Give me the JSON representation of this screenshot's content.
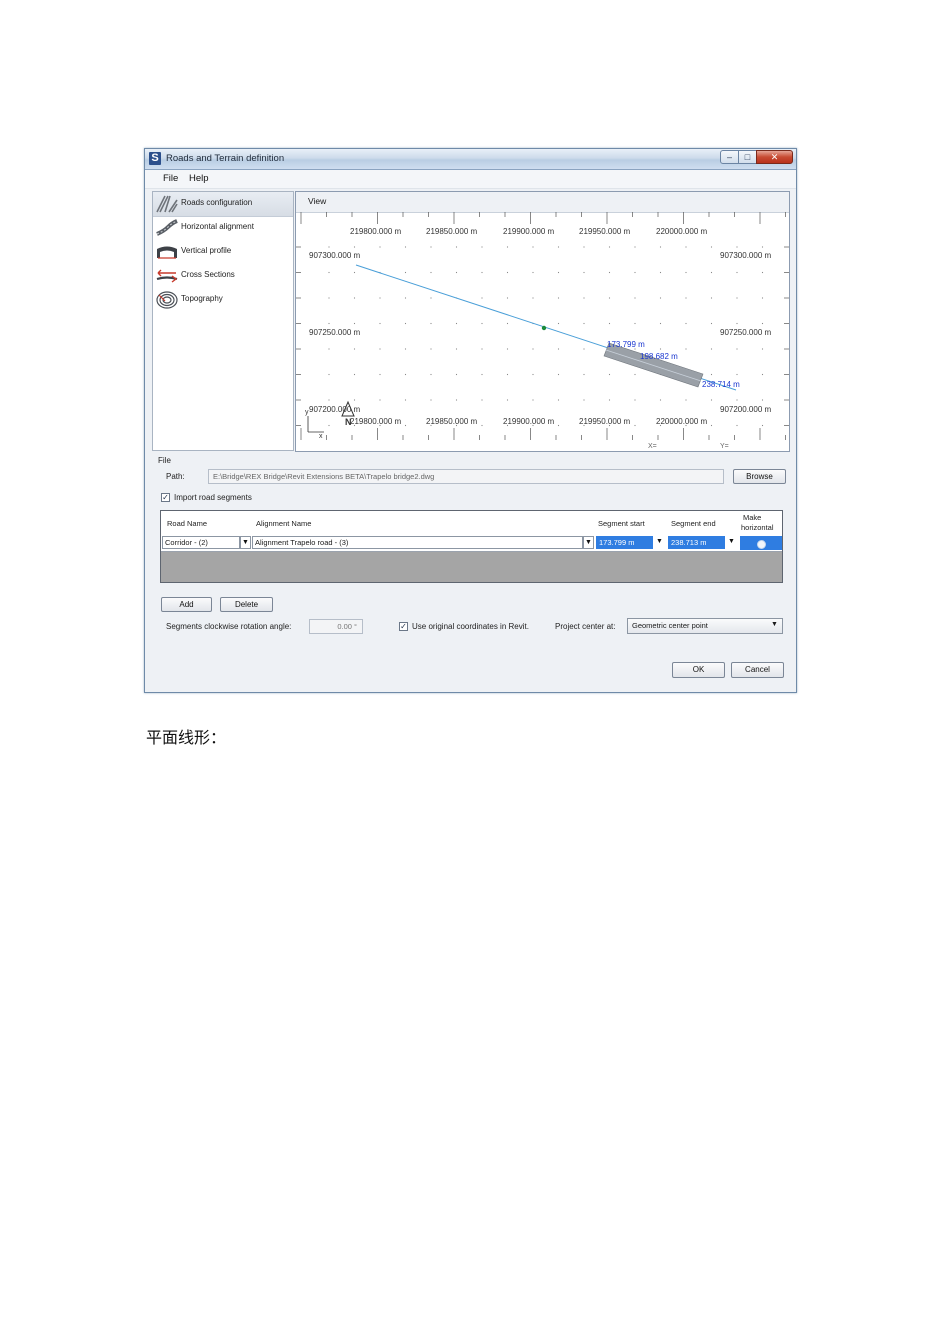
{
  "window": {
    "title": "Roads and Terrain definition",
    "controls": {
      "minimize": "–",
      "maximize": "□",
      "close": "✕"
    }
  },
  "menu": {
    "file": "File",
    "help": "Help"
  },
  "nav": {
    "items": [
      {
        "label": "Roads configuration",
        "icon": "roads-icon",
        "selected": true
      },
      {
        "label": "Horizontal alignment",
        "icon": "alignment-icon",
        "selected": false
      },
      {
        "label": "Vertical profile",
        "icon": "profile-icon",
        "selected": false
      },
      {
        "label": "Cross Sections",
        "icon": "cross-section-icon",
        "selected": false
      },
      {
        "label": "Topography",
        "icon": "topography-icon",
        "selected": false
      }
    ]
  },
  "view": {
    "title": "View",
    "x_ticks": [
      "219800.000 m",
      "219850.000 m",
      "219900.000 m",
      "219950.000 m",
      "220000.000 m"
    ],
    "y_ticks": [
      "907300.000 m",
      "907250.000 m",
      "907200.000 m"
    ],
    "segment_labels": [
      "173.799 m",
      "198.682 m",
      "238.714 m"
    ],
    "axis_y": "y",
    "axis_x": "x",
    "north": "N",
    "coord_x": "X=",
    "coord_y": "Y=",
    "colors": {
      "alignment": "#4a9fd8",
      "segment": "#8e949c",
      "label": "#1a36d0",
      "point": "#1a8a3a"
    }
  },
  "file": {
    "group": "File",
    "path_label": "Path:",
    "path_value": "E:\\Bridge\\REX Bridge\\Revit Extensions BETA\\Trapelo bridge2.dwg",
    "browse": "Browse"
  },
  "import": {
    "checked": true,
    "label": "Import road segments"
  },
  "grid": {
    "headers": {
      "road_name": "Road Name",
      "alignment_name": "Alignment Name",
      "segment_start": "Segment start",
      "segment_end": "Segment end",
      "make_horizontal_1": "Make",
      "make_horizontal_2": "horizontal"
    },
    "row": {
      "road_name": "Corridor - (2)",
      "alignment_name": "Alignment Trapelo road - (3)",
      "segment_start": "173.799 m",
      "segment_end": "238.713 m"
    }
  },
  "buttons": {
    "add": "Add",
    "delete": "Delete",
    "ok": "OK",
    "cancel": "Cancel"
  },
  "rotation": {
    "label": "Segments clockwise rotation angle:",
    "value": "0.00 °"
  },
  "original_coords": {
    "checked": true,
    "label": "Use original coordinates in Revit."
  },
  "project_center": {
    "label": "Project center at:",
    "value": "Geometric center point",
    "arrow": "▼"
  },
  "caption": "平面线形："
}
